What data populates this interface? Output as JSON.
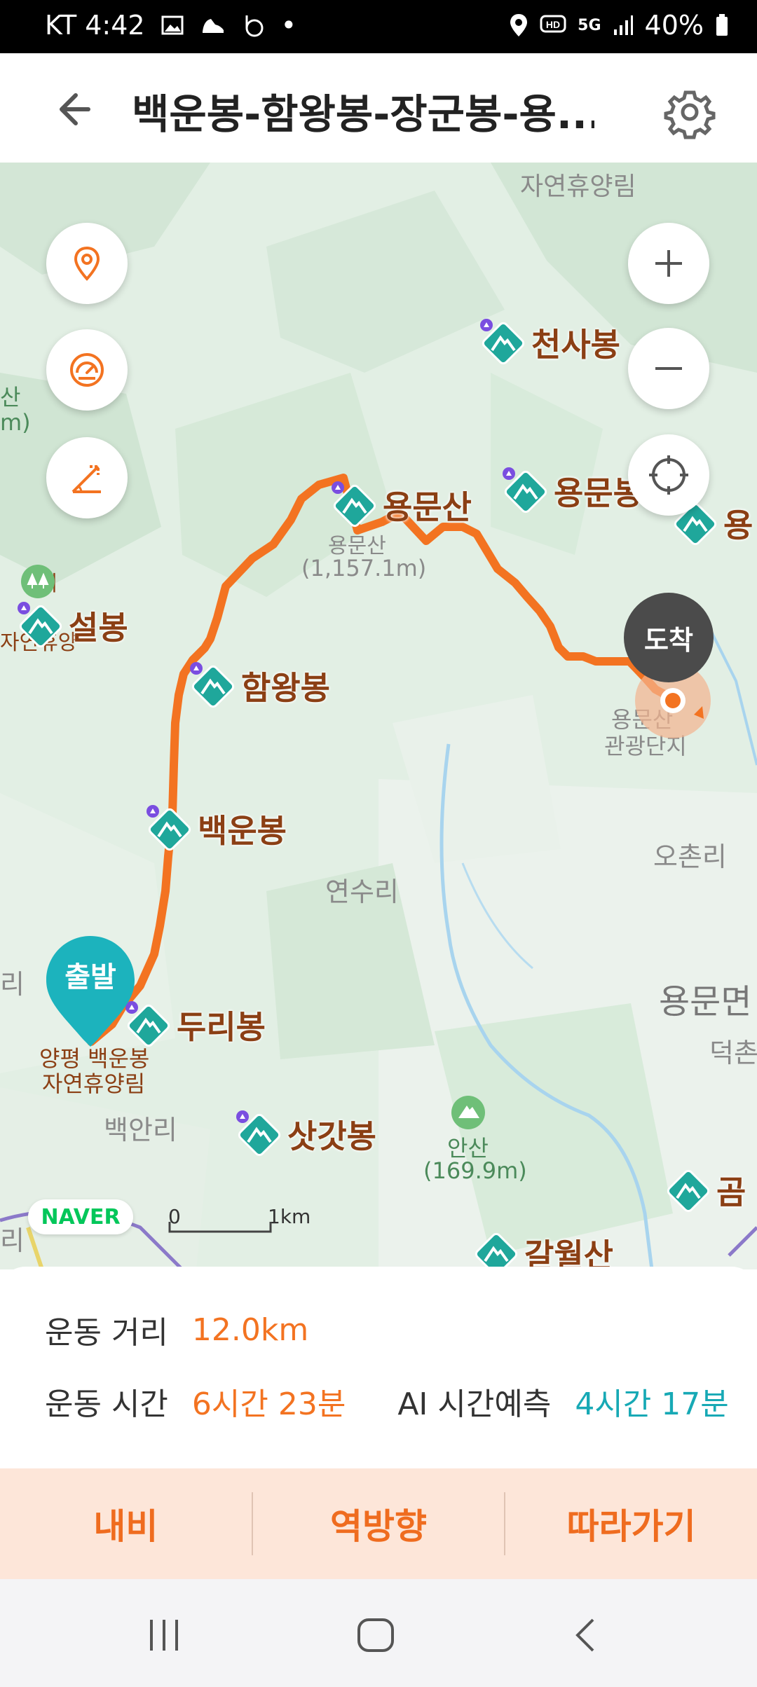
{
  "status_bar": {
    "carrier_time": "KT 4:42",
    "dot": "•",
    "battery": "40%",
    "network": "5G"
  },
  "header": {
    "title": "백운봉-함왕봉-장군봉-용..."
  },
  "map": {
    "places": [
      {
        "key": "p1",
        "text": "자연휴양림"
      },
      {
        "key": "p2",
        "text": "용문산"
      },
      {
        "key": "p3",
        "text": "(1,157.1m)"
      },
      {
        "key": "p4",
        "text": "용문산"
      },
      {
        "key": "p5",
        "text": "관광단지"
      },
      {
        "key": "p6",
        "text": "오촌리"
      },
      {
        "key": "p7",
        "text": "연수리"
      },
      {
        "key": "p8",
        "text": "용문면"
      },
      {
        "key": "p9",
        "text": "덕촌"
      },
      {
        "key": "p10",
        "text": "양평 백운봉"
      },
      {
        "key": "p11",
        "text": "자연휴양림"
      },
      {
        "key": "p12",
        "text": "백안리"
      },
      {
        "key": "p13",
        "text": "안산"
      },
      {
        "key": "p14",
        "text": "(169.9m)"
      },
      {
        "key": "p15",
        "text": "산"
      },
      {
        "key": "p16",
        "text": "m)"
      },
      {
        "key": "p17",
        "text": "재"
      },
      {
        "key": "p18",
        "text": "자연휴양"
      },
      {
        "key": "p19",
        "text": "리"
      },
      {
        "key": "p20",
        "text": "리"
      }
    ],
    "peaks": {
      "cheonsa": "천사봉",
      "yongmunsan": "용문산",
      "yongmunbong": "용문봉",
      "yong_edge": "용",
      "seolbong": "설봉",
      "hamwang": "함왕봉",
      "baegun": "백운봉",
      "duri": "두리봉",
      "satgat": "삿갓봉",
      "galwol": "갈월산",
      "gom": "곰"
    },
    "arrive_label": "도착",
    "start_label": "출발",
    "naver_logo": "NAVER",
    "scale": {
      "zero": "0",
      "unit": "1km"
    }
  },
  "stats": {
    "distance_label": "운동 거리",
    "distance_value": "12.0km",
    "time_label": "운동 시간",
    "time_value": "6시간 23분",
    "ai_label": "AI 시간예측",
    "ai_value": "4시간 17분"
  },
  "actions": {
    "navi": "내비",
    "reverse": "역방향",
    "follow": "따라가기"
  },
  "colors": {
    "route": "#f37321",
    "accent_teal": "#17a9b5",
    "peak_marker": "#1fa79b",
    "arrive_bg": "#4b4b4b"
  }
}
